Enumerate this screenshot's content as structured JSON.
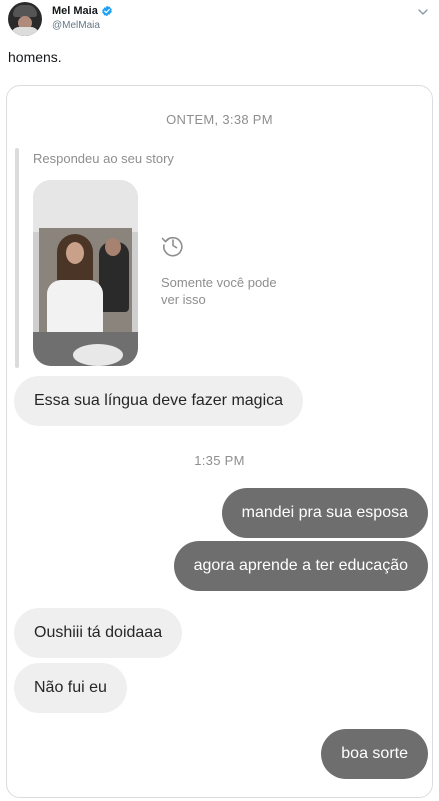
{
  "tweet": {
    "display_name": "Mel Maia",
    "handle": "@MelMaia",
    "verified_icon": "verified-badge-icon",
    "text": "homens."
  },
  "colors": {
    "verified": "#1da1f2",
    "incoming_bubble": "#efefef",
    "outgoing_bubble": "#6e6e6e",
    "meta_text": "#8e8e8e"
  },
  "chat": {
    "timestamp_1": "ONTEM, 3:38 PM",
    "story_caption": "Respondeu ao seu story",
    "story_notice": "Somente você pode ver isso",
    "timestamp_2": "1:35 PM",
    "messages": [
      {
        "direction": "in",
        "text": "Essa sua língua deve fazer magica"
      },
      {
        "direction": "out",
        "text": "mandei pra sua esposa"
      },
      {
        "direction": "out",
        "text": "agora aprende a ter educação"
      },
      {
        "direction": "in",
        "text": "Oushiii tá doidaaa"
      },
      {
        "direction": "in",
        "text": "Não fui eu"
      },
      {
        "direction": "out",
        "text": "boa sorte"
      }
    ]
  }
}
